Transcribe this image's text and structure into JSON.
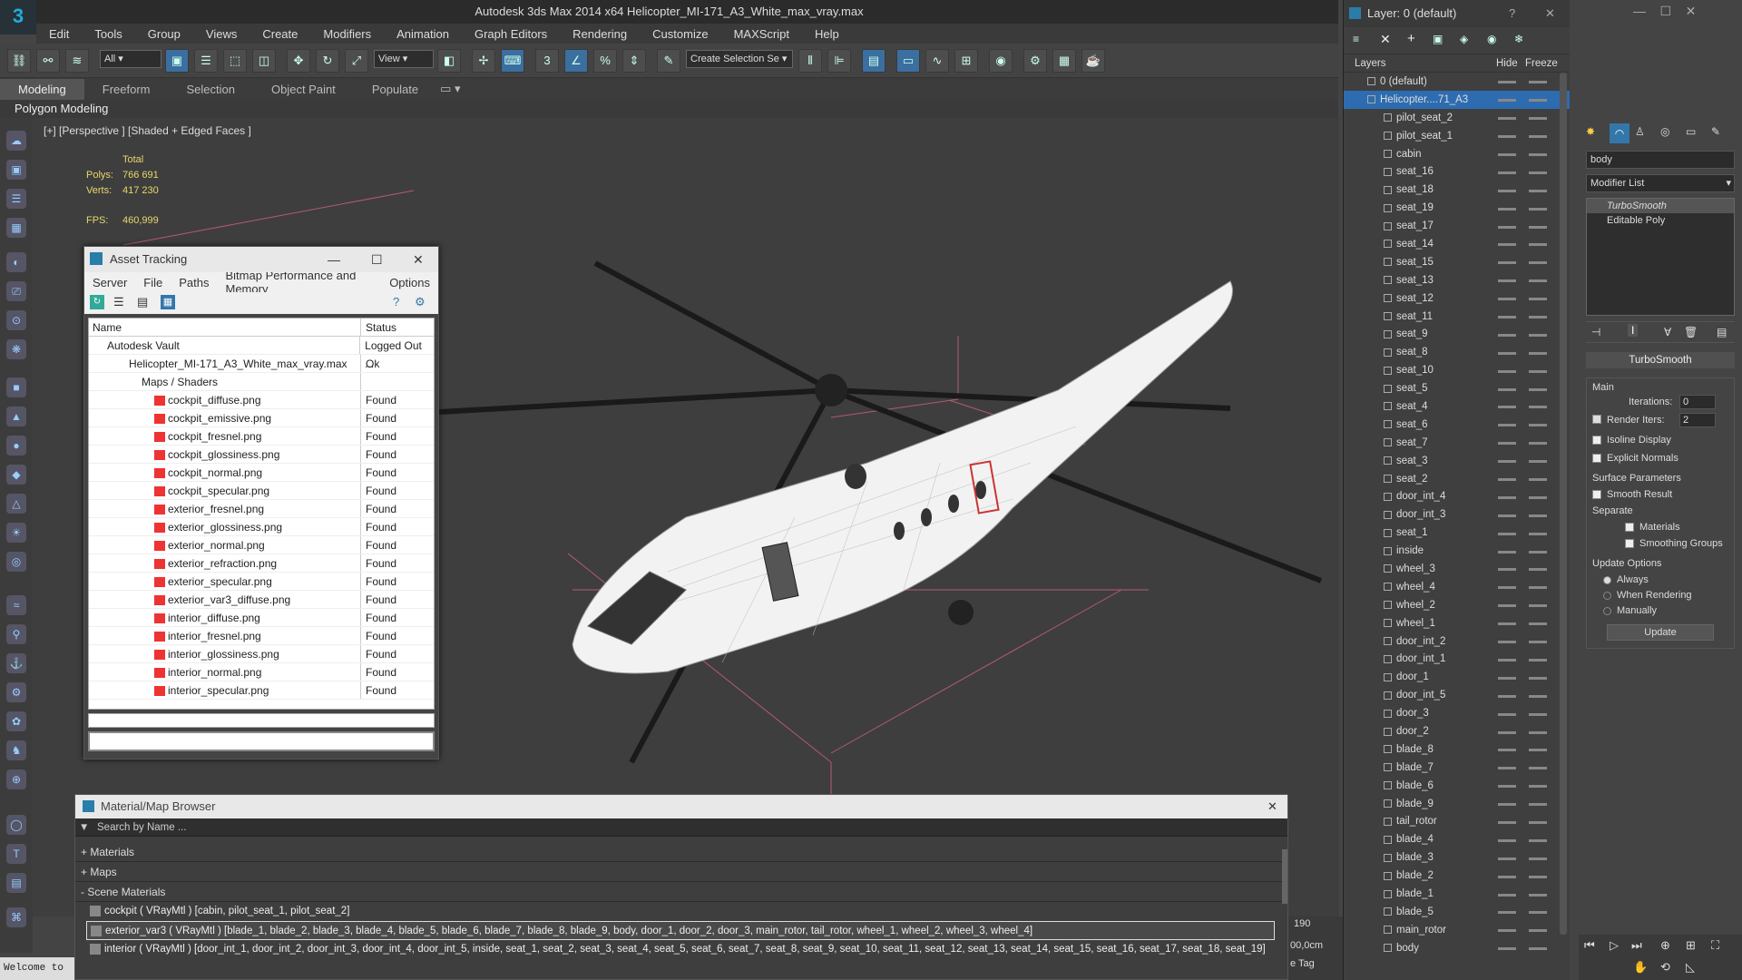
{
  "app": {
    "title": "Autodesk 3ds Max  2014 x64     Helicopter_MI-171_A3_White_max_vray.max"
  },
  "menu": [
    "Edit",
    "Tools",
    "Group",
    "Views",
    "Create",
    "Modifiers",
    "Animation",
    "Graph Editors",
    "Rendering",
    "Customize",
    "MAXScript",
    "Help"
  ],
  "toolbar": {
    "filter": "All",
    "view": "View",
    "selset": "Create Selection Se"
  },
  "ribbon": {
    "tabs": [
      "Modeling",
      "Freeform",
      "Selection",
      "Object Paint",
      "Populate"
    ],
    "subtitle": "Polygon Modeling"
  },
  "viewport": {
    "label": "[+] [Perspective ] [Shaded + Edged Faces ]",
    "total": "Total",
    "polys_label": "Polys:",
    "polys": "766 691",
    "verts_label": "Verts:",
    "verts": "417 230",
    "fps_label": "FPS:",
    "fps": "460,999"
  },
  "asset_tracking": {
    "title": "Asset Tracking",
    "menu": [
      "Server",
      "File",
      "Paths",
      "Bitmap Performance and Memory",
      "Options"
    ],
    "col_name": "Name",
    "col_status": "Status",
    "rows": [
      {
        "name": "Autodesk Vault",
        "status": "Logged Out ..."
      },
      {
        "name": "Helicopter_MI-171_A3_White_max_vray.max",
        "status": "Ok"
      },
      {
        "name": "Maps / Shaders",
        "status": ""
      },
      {
        "name": "cockpit_diffuse.png",
        "status": "Found"
      },
      {
        "name": "cockpit_emissive.png",
        "status": "Found"
      },
      {
        "name": "cockpit_fresnel.png",
        "status": "Found"
      },
      {
        "name": "cockpit_glossiness.png",
        "status": "Found"
      },
      {
        "name": "cockpit_normal.png",
        "status": "Found"
      },
      {
        "name": "cockpit_specular.png",
        "status": "Found"
      },
      {
        "name": "exterior_fresnel.png",
        "status": "Found"
      },
      {
        "name": "exterior_glossiness.png",
        "status": "Found"
      },
      {
        "name": "exterior_normal.png",
        "status": "Found"
      },
      {
        "name": "exterior_refraction.png",
        "status": "Found"
      },
      {
        "name": "exterior_specular.png",
        "status": "Found"
      },
      {
        "name": "exterior_var3_diffuse.png",
        "status": "Found"
      },
      {
        "name": "interior_diffuse.png",
        "status": "Found"
      },
      {
        "name": "interior_fresnel.png",
        "status": "Found"
      },
      {
        "name": "interior_glossiness.png",
        "status": "Found"
      },
      {
        "name": "interior_normal.png",
        "status": "Found"
      },
      {
        "name": "interior_specular.png",
        "status": "Found"
      }
    ]
  },
  "layers": {
    "title": "Layer: 0 (default)",
    "col_layers": "Layers",
    "col_hide": "Hide",
    "col_freeze": "Freeze",
    "items": [
      "0 (default)",
      "Helicopter....71_A3",
      "pilot_seat_2",
      "pilot_seat_1",
      "cabin",
      "seat_16",
      "seat_18",
      "seat_19",
      "seat_17",
      "seat_14",
      "seat_15",
      "seat_13",
      "seat_12",
      "seat_11",
      "seat_9",
      "seat_8",
      "seat_10",
      "seat_5",
      "seat_4",
      "seat_6",
      "seat_7",
      "seat_3",
      "seat_2",
      "door_int_4",
      "door_int_3",
      "seat_1",
      "inside",
      "wheel_3",
      "wheel_4",
      "wheel_2",
      "wheel_1",
      "door_int_2",
      "door_int_1",
      "door_1",
      "door_int_5",
      "door_3",
      "door_2",
      "blade_8",
      "blade_7",
      "blade_6",
      "blade_9",
      "tail_rotor",
      "blade_4",
      "blade_3",
      "blade_2",
      "blade_1",
      "blade_5",
      "main_rotor",
      "body"
    ]
  },
  "command_panel": {
    "object_name": "body",
    "modifier_list": "Modifier List",
    "stack": [
      "TurboSmooth",
      "Editable Poly"
    ],
    "rollout": "TurboSmooth",
    "main": "Main",
    "iterations_label": "Iterations:",
    "iterations": "0",
    "render_iters_label": "Render Iters:",
    "render_iters": "2",
    "isoline": "Isoline Display",
    "explicit": "Explicit Normals",
    "surface": "Surface Parameters",
    "smooth_result": "Smooth Result",
    "separate": "Separate",
    "materials": "Materials",
    "smoothing": "Smoothing Groups",
    "update_options": "Update Options",
    "always": "Always",
    "when_rendering": "When Rendering",
    "manually": "Manually",
    "update": "Update"
  },
  "material_browser": {
    "title": "Material/Map Browser",
    "search": "Search by Name ...",
    "groups": [
      "+ Materials",
      "+ Maps",
      "- Scene Materials"
    ],
    "items": [
      "cockpit  ( VRayMtl )  [cabin, pilot_seat_1, pilot_seat_2]",
      "exterior_var3  ( VRayMtl )  [blade_1, blade_2, blade_3, blade_4, blade_5, blade_6, blade_7, blade_8, blade_9, body, door_1, door_2, door_3, main_rotor, tail_rotor, wheel_1, wheel_2, wheel_3, wheel_4]",
      "interior  ( VRayMtl )  [door_int_1, door_int_2, door_int_3, door_int_4, door_int_5, inside, seat_1, seat_2, seat_3, seat_4, seat_5, seat_6, seat_7, seat_8, seat_9, seat_10, seat_11, seat_12, seat_13, seat_14, seat_15, seat_16, seat_17, seat_18, seat_19]"
    ]
  },
  "status": {
    "welcome": "Welcome to",
    "frame": "190",
    "unit": "00,0cm",
    "tag": "e Tag"
  }
}
